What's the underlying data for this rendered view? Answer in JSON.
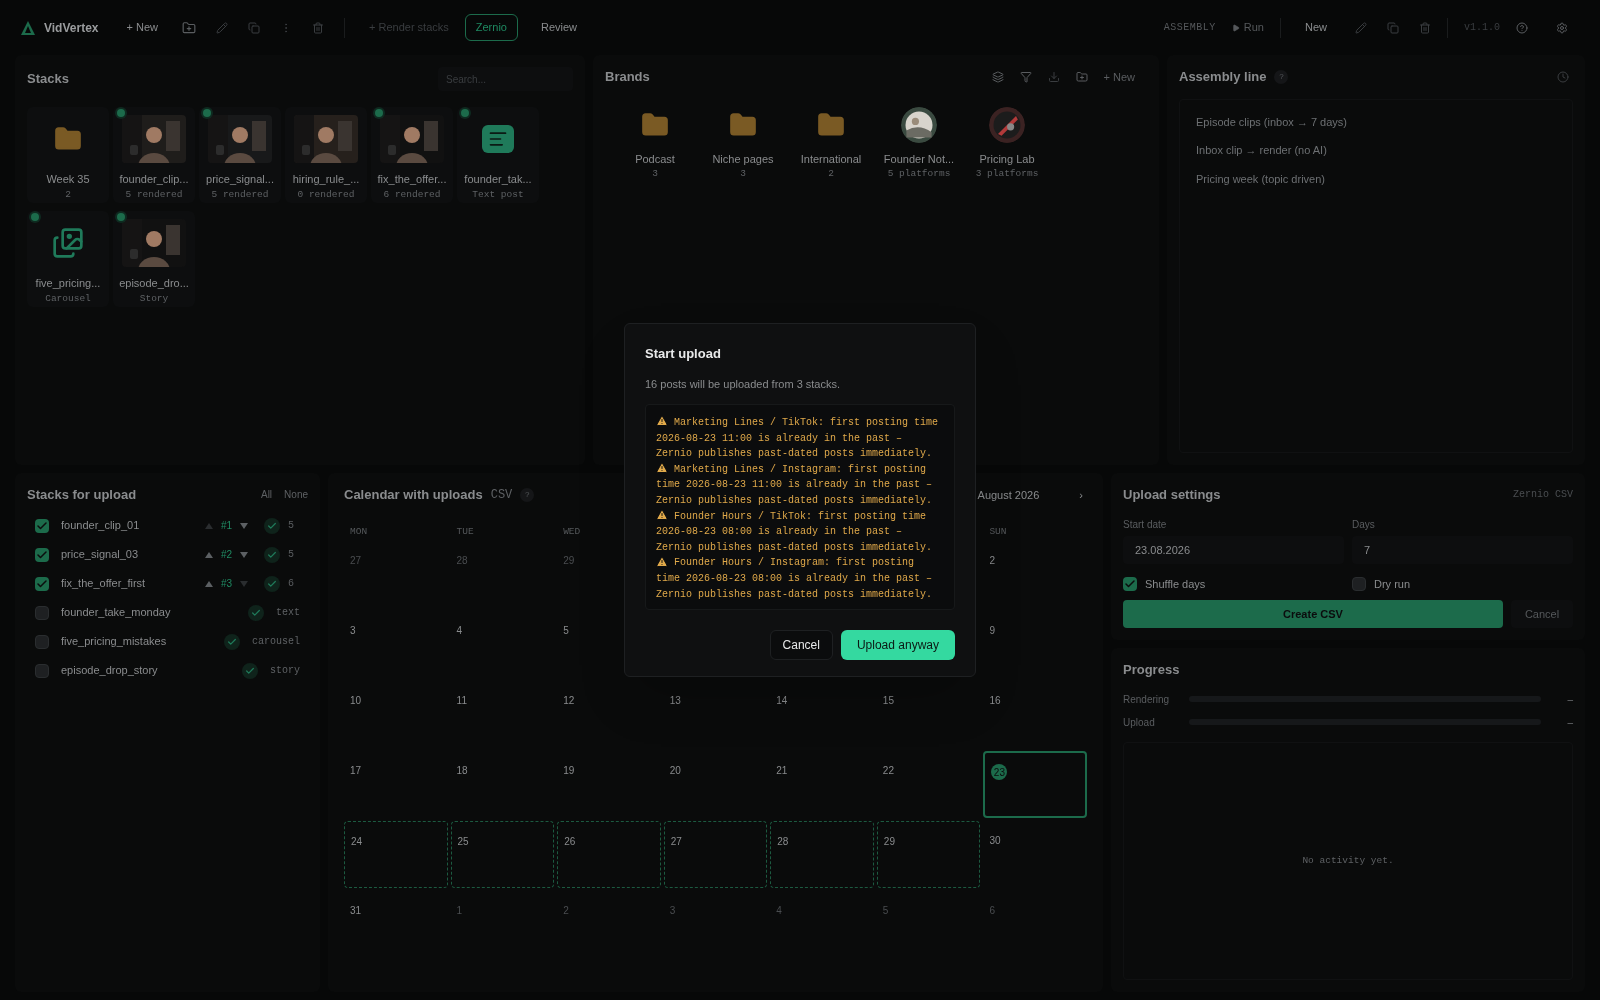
{
  "app": {
    "name": "VidVertex"
  },
  "toolbar": {
    "new_label": "+ New",
    "render_label": "+ Render stacks",
    "tabs": [
      {
        "label": "Zernio",
        "selected": true
      },
      {
        "label": "Review",
        "selected": false
      }
    ],
    "assembly_label": "ASSEMBLY",
    "run_label": "Run",
    "new_right": "New",
    "version": "v1.1.0"
  },
  "stacks": {
    "title": "Stacks",
    "search_placeholder": "Search...",
    "items": [
      {
        "name": "Week 35",
        "sub": "2",
        "kind": "folder",
        "ready": false
      },
      {
        "name": "founder_clip...",
        "sub": "5 rendered",
        "kind": "video",
        "ready": true
      },
      {
        "name": "price_signal...",
        "sub": "5 rendered",
        "kind": "video",
        "ready": true
      },
      {
        "name": "hiring_rule_...",
        "sub": "0 rendered",
        "kind": "video",
        "ready": false
      },
      {
        "name": "fix_the_offer...",
        "sub": "6 rendered",
        "kind": "video",
        "ready": true
      },
      {
        "name": "founder_tak...",
        "sub": "Text post",
        "kind": "text",
        "ready": true
      },
      {
        "name": "five_pricing...",
        "sub": "Carousel",
        "kind": "carousel",
        "ready": true
      },
      {
        "name": "episode_dro...",
        "sub": "Story",
        "kind": "story",
        "ready": true
      }
    ]
  },
  "brands": {
    "title": "Brands",
    "new_label": "+ New",
    "items": [
      {
        "name": "Podcast",
        "sub": "3",
        "kind": "folder"
      },
      {
        "name": "Niche pages",
        "sub": "3",
        "kind": "folder"
      },
      {
        "name": "International",
        "sub": "2",
        "kind": "folder"
      },
      {
        "name": "Founder Not...",
        "sub": "5 platforms",
        "kind": "avatar"
      },
      {
        "name": "Pricing Lab",
        "sub": "3 platforms",
        "kind": "avatar"
      }
    ]
  },
  "assembly": {
    "title": "Assembly line",
    "help": "?",
    "items": [
      "Episode clips (inbox → 7 days)",
      "Inbox clip → render (no AI)",
      "Pricing week (topic driven)"
    ]
  },
  "upload_stacks": {
    "title": "Stacks for upload",
    "all": "All",
    "none": "None",
    "rows": [
      {
        "name": "founder_clip_01",
        "checked": true,
        "kind": "ranked",
        "rank": "#1",
        "can_up": false,
        "can_down": true,
        "count": "5"
      },
      {
        "name": "price_signal_03",
        "checked": true,
        "kind": "ranked",
        "rank": "#2",
        "can_up": true,
        "can_down": true,
        "count": "5"
      },
      {
        "name": "fix_the_offer_first",
        "checked": true,
        "kind": "ranked",
        "rank": "#3",
        "can_up": true,
        "can_down": false,
        "count": "6"
      },
      {
        "name": "founder_take_monday",
        "checked": false,
        "kind": "typed",
        "type": "text"
      },
      {
        "name": "five_pricing_mistakes",
        "checked": false,
        "kind": "typed",
        "type": "carousel"
      },
      {
        "name": "episode_drop_story",
        "checked": false,
        "kind": "typed",
        "type": "story"
      }
    ]
  },
  "calendar": {
    "title": "Calendar with uploads",
    "badge": "CSV",
    "help": "?",
    "month": "August 2026",
    "next": "›",
    "weekdays": {
      "start": [
        "MON",
        "TUE",
        "WED"
      ],
      "end": [
        "SUN"
      ]
    },
    "weeks": [
      {
        "start": [
          {
            "day": "27",
            "kind": "muted"
          },
          {
            "day": "28",
            "kind": "muted"
          },
          {
            "day": "29",
            "kind": "muted"
          }
        ],
        "end": [
          {
            "day": "2",
            "kind": "plain"
          }
        ]
      },
      {
        "start": [
          {
            "day": "3",
            "kind": "plain"
          },
          {
            "day": "4",
            "kind": "plain"
          },
          {
            "day": "5",
            "kind": "plain"
          }
        ],
        "end": [
          {
            "day": "9",
            "kind": "plain"
          }
        ]
      },
      {
        "days": [
          {
            "day": "10",
            "kind": "plain"
          },
          {
            "day": "11",
            "kind": "plain"
          },
          {
            "day": "12",
            "kind": "plain"
          },
          {
            "day": "13",
            "kind": "plain"
          },
          {
            "day": "14",
            "kind": "plain"
          },
          {
            "day": "15",
            "kind": "plain"
          },
          {
            "day": "16",
            "kind": "plain"
          }
        ]
      },
      {
        "days": [
          {
            "day": "17",
            "kind": "plain"
          },
          {
            "day": "18",
            "kind": "plain"
          },
          {
            "day": "19",
            "kind": "plain"
          },
          {
            "day": "20",
            "kind": "plain"
          },
          {
            "day": "21",
            "kind": "plain"
          },
          {
            "day": "22",
            "kind": "plain"
          },
          {
            "day": "23",
            "kind": "today"
          }
        ]
      },
      {
        "days": [
          {
            "day": "24",
            "kind": "scheduled"
          },
          {
            "day": "25",
            "kind": "scheduled"
          },
          {
            "day": "26",
            "kind": "scheduled"
          },
          {
            "day": "27",
            "kind": "scheduled"
          },
          {
            "day": "28",
            "kind": "scheduled"
          },
          {
            "day": "29",
            "kind": "scheduled"
          },
          {
            "day": "30",
            "kind": "plain"
          }
        ]
      },
      {
        "days": [
          {
            "day": "31",
            "kind": "plain"
          },
          {
            "day": "1",
            "kind": "muted"
          },
          {
            "day": "2",
            "kind": "muted"
          },
          {
            "day": "3",
            "kind": "muted"
          },
          {
            "day": "4",
            "kind": "muted"
          },
          {
            "day": "5",
            "kind": "muted"
          },
          {
            "day": "6",
            "kind": "muted"
          }
        ]
      }
    ]
  },
  "settings": {
    "title": "Upload settings",
    "target": "Zernio CSV",
    "start_label": "Start date",
    "start_value": "23.08.2026",
    "days_label": "Days",
    "days_value": "7",
    "shuffle": {
      "label": "Shuffle days",
      "checked": true
    },
    "dry_run": {
      "label": "Dry run",
      "checked": false
    },
    "create_label": "Create CSV",
    "cancel_label": "Cancel"
  },
  "progress": {
    "title": "Progress",
    "bars": [
      {
        "label": "Rendering",
        "reading": "–"
      },
      {
        "label": "Upload",
        "reading": "–"
      }
    ],
    "empty": "No activity yet."
  },
  "modal": {
    "title": "Start upload",
    "summary": "16 posts will be uploaded from 3 stacks.",
    "warnings": [
      "Marketing Lines / TikTok: first posting time 2026-08-23 11:00 is already in the past – Zernio publishes past-dated posts immediately.",
      "Marketing Lines / Instagram: first posting time 2026-08-23 11:00 is already in the past – Zernio publishes past-dated posts immediately.",
      "Founder Hours / TikTok: first posting time 2026-08-23 08:00 is already in the past – Zernio publishes past-dated posts immediately.",
      "Founder Hours / Instagram: first posting time 2026-08-23 08:00 is already in the past – Zernio publishes past-dated posts immediately."
    ],
    "cancel_label": "Cancel",
    "confirm_label": "Upload anyway"
  }
}
